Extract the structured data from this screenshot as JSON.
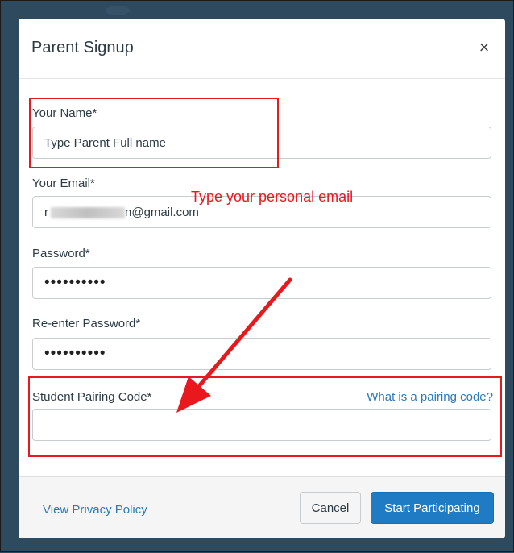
{
  "modal": {
    "title": "Parent Signup",
    "close_symbol": "×"
  },
  "form": {
    "name_label": "Your Name*",
    "name_value": "Type Parent Full name",
    "email_label": "Your Email*",
    "email_prefix": "r",
    "email_domain": "n@gmail.com",
    "password_label": "Password*",
    "password_value": "••••••••••",
    "reenter_label": "Re-enter Password*",
    "reenter_value": "••••••••••",
    "pairing_label": "Student Pairing Code*",
    "pairing_link": "What is a pairing code?",
    "pairing_value": ""
  },
  "annotations": {
    "email_hint": "Type your personal email",
    "color": "#e8181d"
  },
  "footer": {
    "privacy_link": "View Privacy Policy",
    "cancel_label": "Cancel",
    "start_label": "Start Participating"
  },
  "colors": {
    "primary": "#1f7cc4",
    "link": "#2a7abc",
    "annotation": "#e8181d"
  }
}
